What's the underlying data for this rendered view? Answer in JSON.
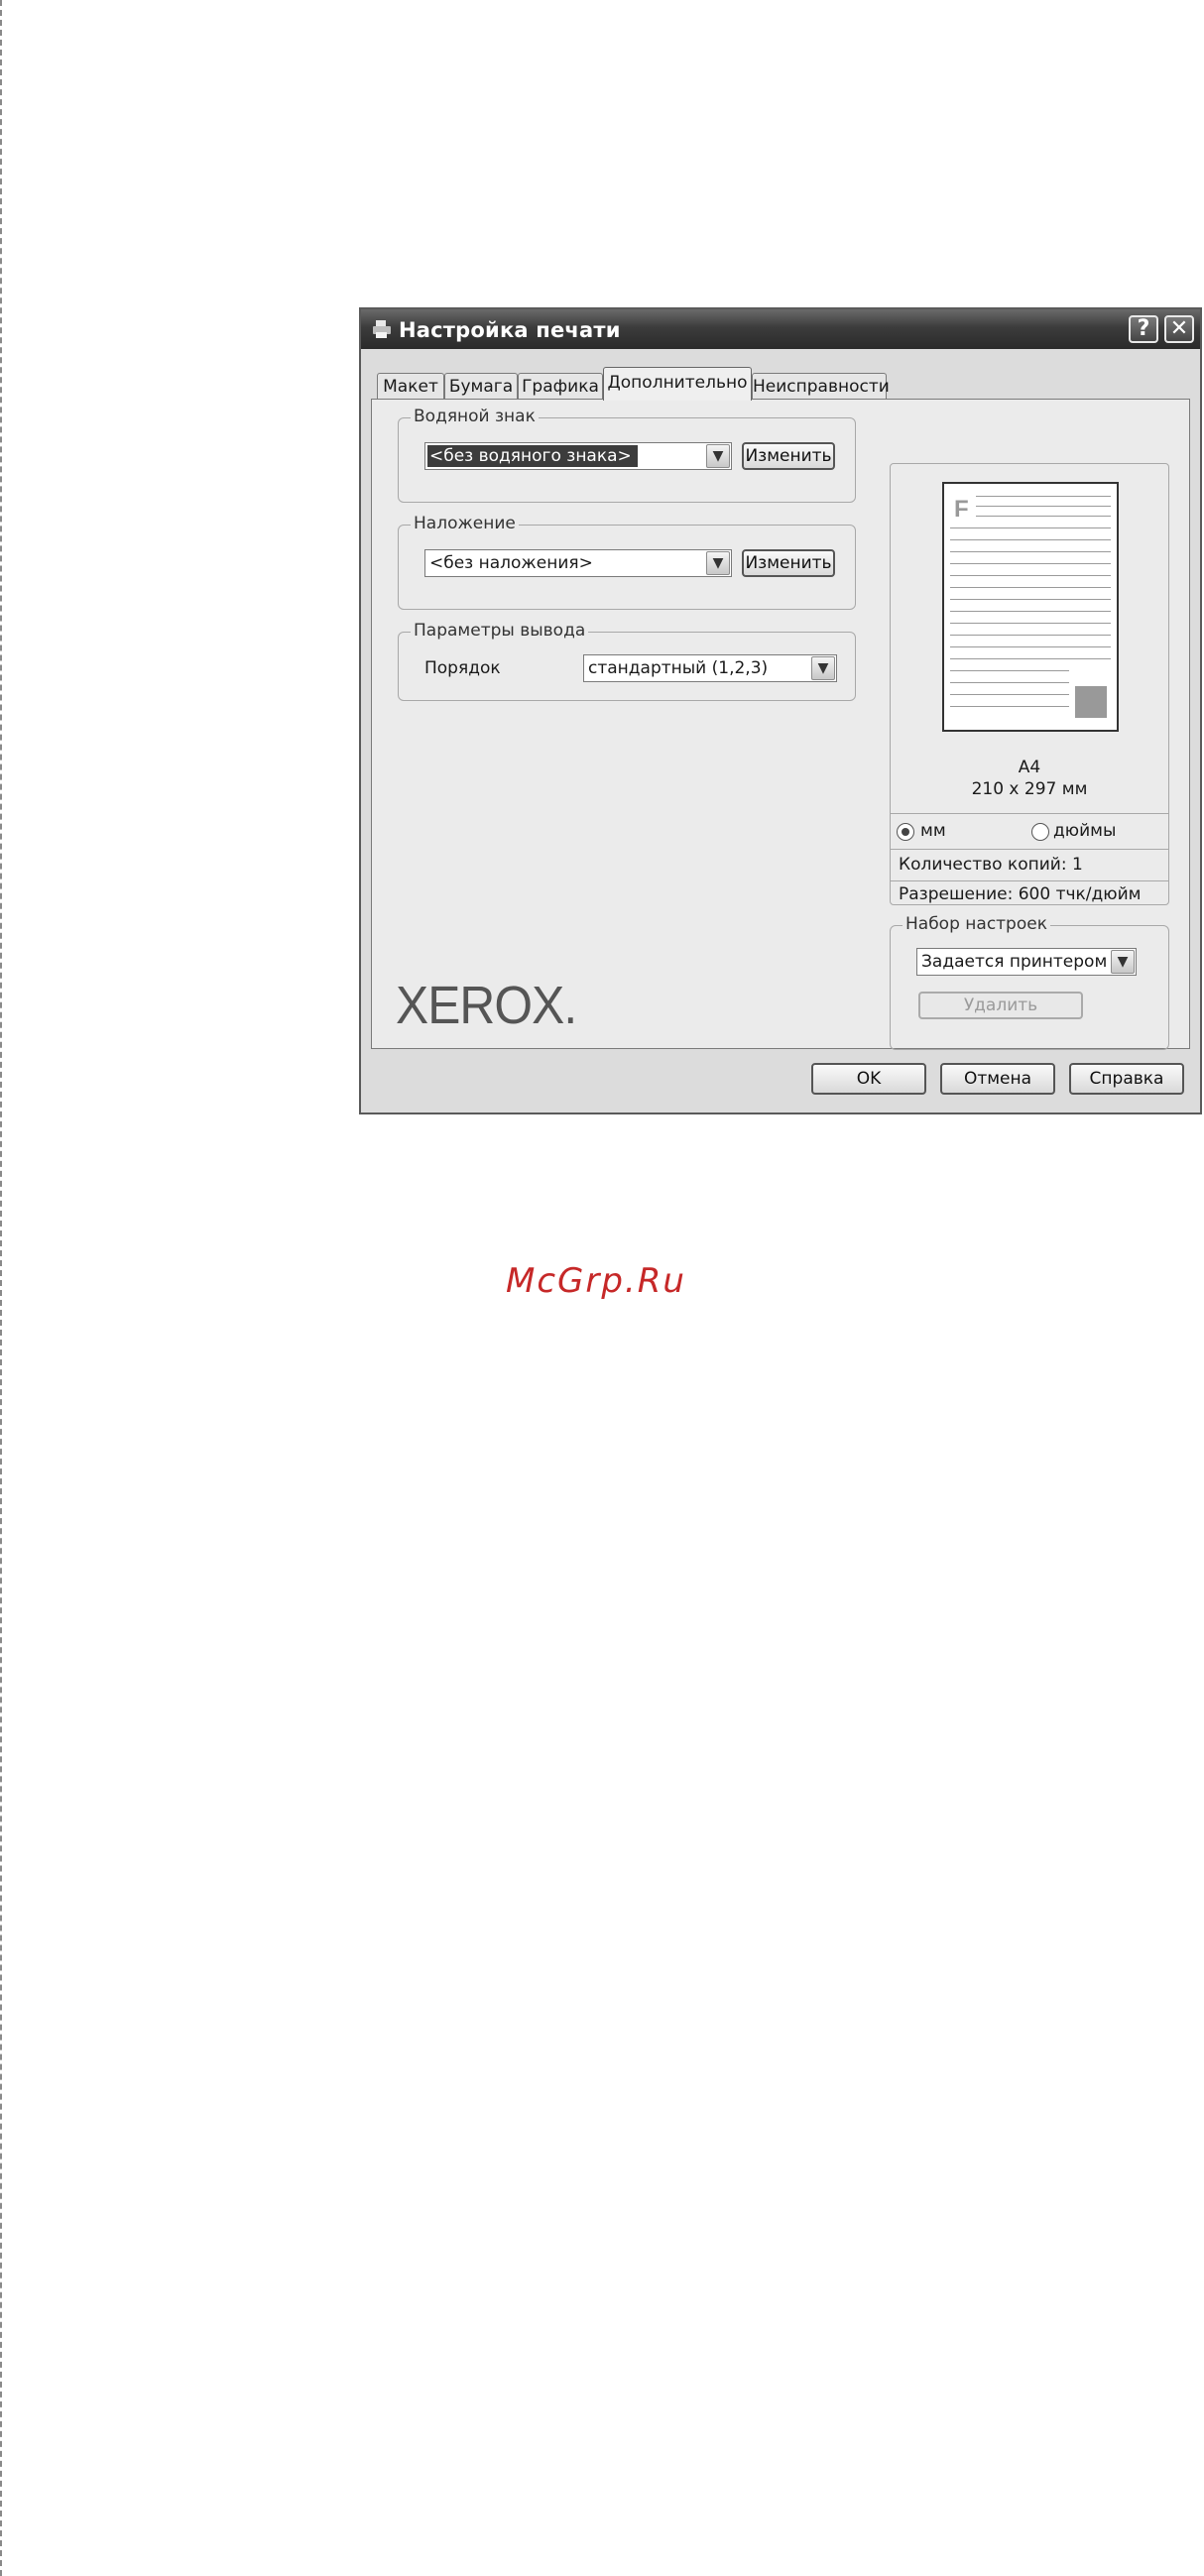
{
  "window": {
    "title": "Настройка печати",
    "help_glyph": "?",
    "close_glyph": "✕",
    "icon": "printer-icon"
  },
  "tabs": [
    {
      "label": "Макет"
    },
    {
      "label": "Бумага"
    },
    {
      "label": "Графика"
    },
    {
      "label": "Дополнительно",
      "active": true
    },
    {
      "label": "Неисправности"
    }
  ],
  "watermark": {
    "group_label": "Водяной знак",
    "selected": "<без водяного знака>",
    "edit_label": "Изменить"
  },
  "overlay": {
    "group_label": "Наложение",
    "selected": "<без наложения>",
    "edit_label": "Изменить"
  },
  "output": {
    "group_label": "Параметры вывода",
    "order_label": "Порядок",
    "order_selected": "стандартный (1,2,3)"
  },
  "preview": {
    "page_letter": "F",
    "paper_name": "A4",
    "paper_size": "210 x 297 мм",
    "unit_mm": "мм",
    "unit_inch": "дюймы",
    "selected_unit": "мм",
    "copies": "Количество копий: 1",
    "resolution": "Разрешение: 600 тчк/дюйм"
  },
  "presets": {
    "group_label": "Набор настроек",
    "selected": "Задается принтером",
    "delete_label": "Удалить"
  },
  "brand": {
    "logo": "XEROX."
  },
  "footer": {
    "ok_label": "OK",
    "cancel_label": "Отмена",
    "help_label": "Справка"
  },
  "page_watermark": "McGrp.Ru",
  "colors": {
    "titlebar": "#3c3c3c",
    "watermark_red": "#c62828"
  }
}
